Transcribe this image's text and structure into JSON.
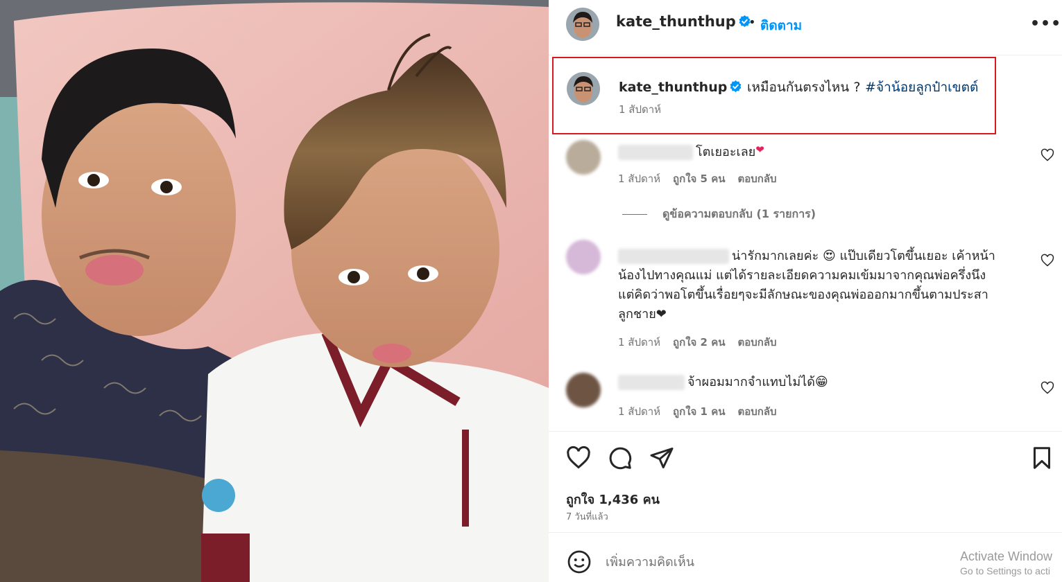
{
  "post": {
    "username": "kate_thunthup",
    "follow_label": "ติดตาม",
    "separator": "•",
    "more_label": "•••",
    "caption": {
      "username": "kate_thunthup",
      "text": "เหมือนกันตรงไหน ?",
      "hashtag": "#จ้าน้อยลูกป๋าเขตต์",
      "time": "1 สัปดาห์"
    }
  },
  "comments": [
    {
      "text": "โตเยอะเลย",
      "emoji": "❤",
      "time": "1 สัปดาห์",
      "likes": "ถูกใจ 5 คน",
      "reply_label": "ตอบกลับ"
    },
    {
      "text_lines": [
        "น่ารักมากเลยค่ะ 😍 แป๊บเดียวโตขึ้นเยอะ เค้าหน้า",
        "น้องไปทางคุณแม่ แต่ได้รายละเอียดความคมเข้มมาจากคุณพ่อครึ่งนึง",
        "แต่คิดว่าพอโตขึ้นเรื่อยๆจะมีลักษณะของคุณพ่อออกมากขึ้นตามประสา",
        "ลูกชาย❤"
      ],
      "time": "1 สัปดาห์",
      "likes": "ถูกใจ 2 คน",
      "reply_label": "ตอบกลับ"
    },
    {
      "text": "จ้าผอมมากจำแทบไม่ได้😁",
      "time": "1 สัปดาห์",
      "likes": "ถูกใจ 1 คน",
      "reply_label": "ตอบกลับ"
    }
  ],
  "view_replies": "ดูข้อความตอบกลับ (1 รายการ)",
  "likes_total": "ถูกใจ 1,436 คน",
  "posted_ago": "7 วันที่แล้ว",
  "add_comment_placeholder": "เพิ่มความคิดเห็น",
  "watermark": {
    "line1": "Activate Window",
    "line2": "Go to Settings to acti"
  },
  "icons": {
    "verified": "verified-badge-icon",
    "heart": "heart-icon",
    "comment": "comment-icon",
    "share": "share-icon",
    "save": "bookmark-icon",
    "emoji": "emoji-icon"
  },
  "colors": {
    "link_blue": "#0095f6",
    "hashtag": "#00376b",
    "highlight_border": "#d71920",
    "secondary_text": "#737373"
  }
}
